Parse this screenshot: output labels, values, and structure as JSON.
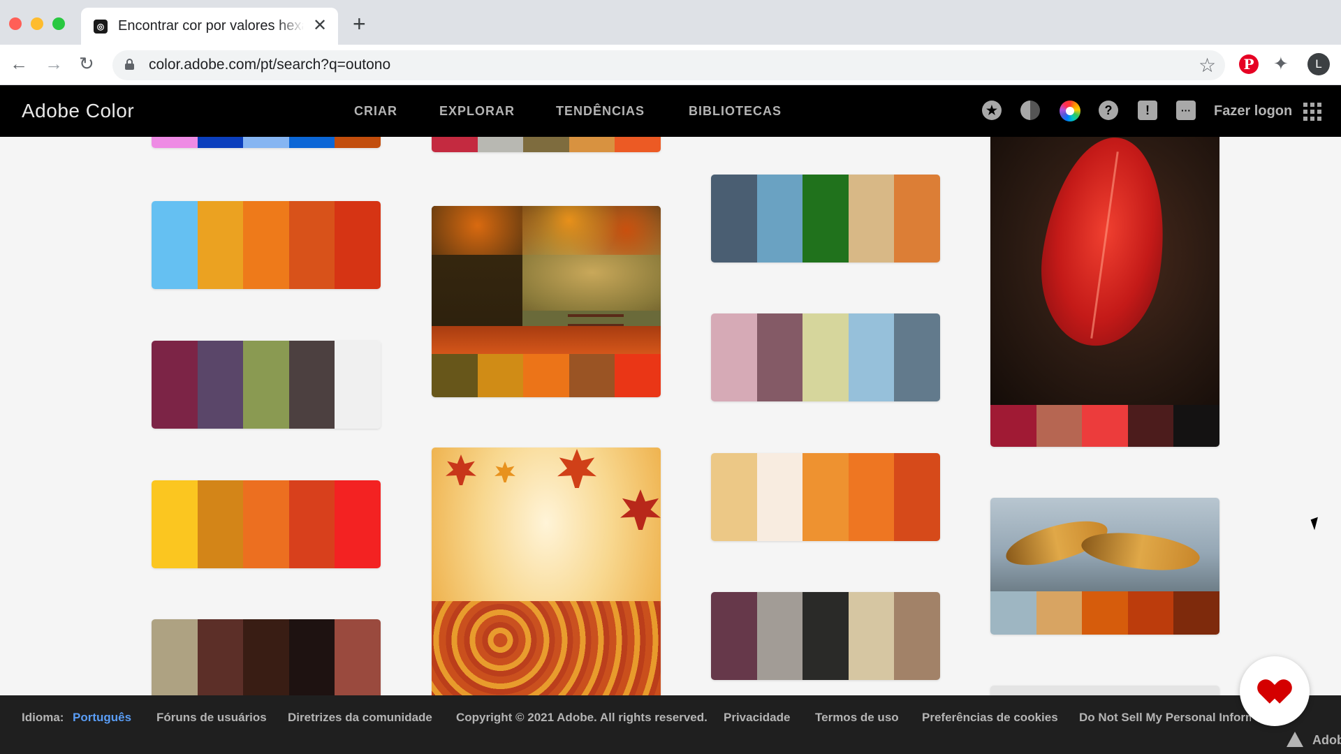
{
  "browser": {
    "tab_title": "Encontrar cor por valores hexadecimais",
    "url": "color.adobe.com/pt/search?q=outono",
    "profile_initial": "L"
  },
  "header": {
    "brand": "Adobe Color",
    "nav": [
      "CRIAR",
      "EXPLORAR",
      "TENDÊNCIAS",
      "BIBLIOTECAS"
    ],
    "signin": "Fazer logon",
    "icons": [
      "favorites-icon",
      "accessibility-icon",
      "color-wheel-icon",
      "help-icon",
      "report-icon",
      "feedback-icon",
      "apps-icon"
    ]
  },
  "palettes": {
    "col1": [
      {
        "colors": [
          "#ee8be4",
          "#0b3fbd",
          "#86b5f2",
          "#0b66d6",
          "#c24d0c"
        ]
      },
      {
        "colors": [
          "#65c0f2",
          "#eba221",
          "#ee7a1a",
          "#d8521a",
          "#d63414"
        ]
      },
      {
        "colors": [
          "#7c2446",
          "#5a4669",
          "#8a9a52",
          "#4c4040",
          "#f0f0f0"
        ]
      },
      {
        "colors": [
          "#fbc620",
          "#d38518",
          "#ec6f20",
          "#d8401c",
          "#f32222"
        ]
      },
      {
        "colors": [
          "#aea282",
          "#5c2f28",
          "#391d14",
          "#1e1211",
          "#9a4a3e"
        ]
      }
    ],
    "col2": [
      {
        "colors": [
          "#c42a40",
          "#b8b8b2",
          "#7e6c3e",
          "#d89240",
          "#ec5a24"
        ]
      },
      {
        "colors": [
          "#67561a",
          "#d08c16",
          "#ec7418",
          "#9a5424",
          "#ea3616"
        ]
      },
      {
        "colors": []
      }
    ],
    "col3": [
      {
        "colors": [
          "#4a5e72",
          "#6aa2c2",
          "#20721c",
          "#d8b886",
          "#dc7e36"
        ]
      },
      {
        "colors": [
          "#d6aab6",
          "#845a66",
          "#d6d69c",
          "#96c0da",
          "#627a8c"
        ]
      },
      {
        "colors": [
          "#ecc886",
          "#f8ece0",
          "#ee9230",
          "#ee7622",
          "#d64a1a"
        ]
      },
      {
        "colors": [
          "#66384a",
          "#a29c96",
          "#2a2a28",
          "#d6c6a2",
          "#a28268"
        ]
      }
    ],
    "col4": [
      {
        "colors": [
          "#a01a34",
          "#b66652",
          "#ec3c3c",
          "#4c1c1c",
          "#141212"
        ]
      },
      {
        "colors": [
          "#9eb6c2",
          "#d8a462",
          "#d65c0c",
          "#bc3c0c",
          "#7e2a0c"
        ]
      }
    ]
  },
  "footer": {
    "language_label": "Idioma:",
    "language_value": "Português",
    "links": [
      "Fóruns de usuários",
      "Diretrizes da comunidade",
      "Copyright © 2021 Adobe. All rights reserved.",
      "Privacidade",
      "Termos de uso",
      "Preferências de cookies",
      "Do Not Sell My Personal Information"
    ],
    "brand_text": "Adobe"
  }
}
